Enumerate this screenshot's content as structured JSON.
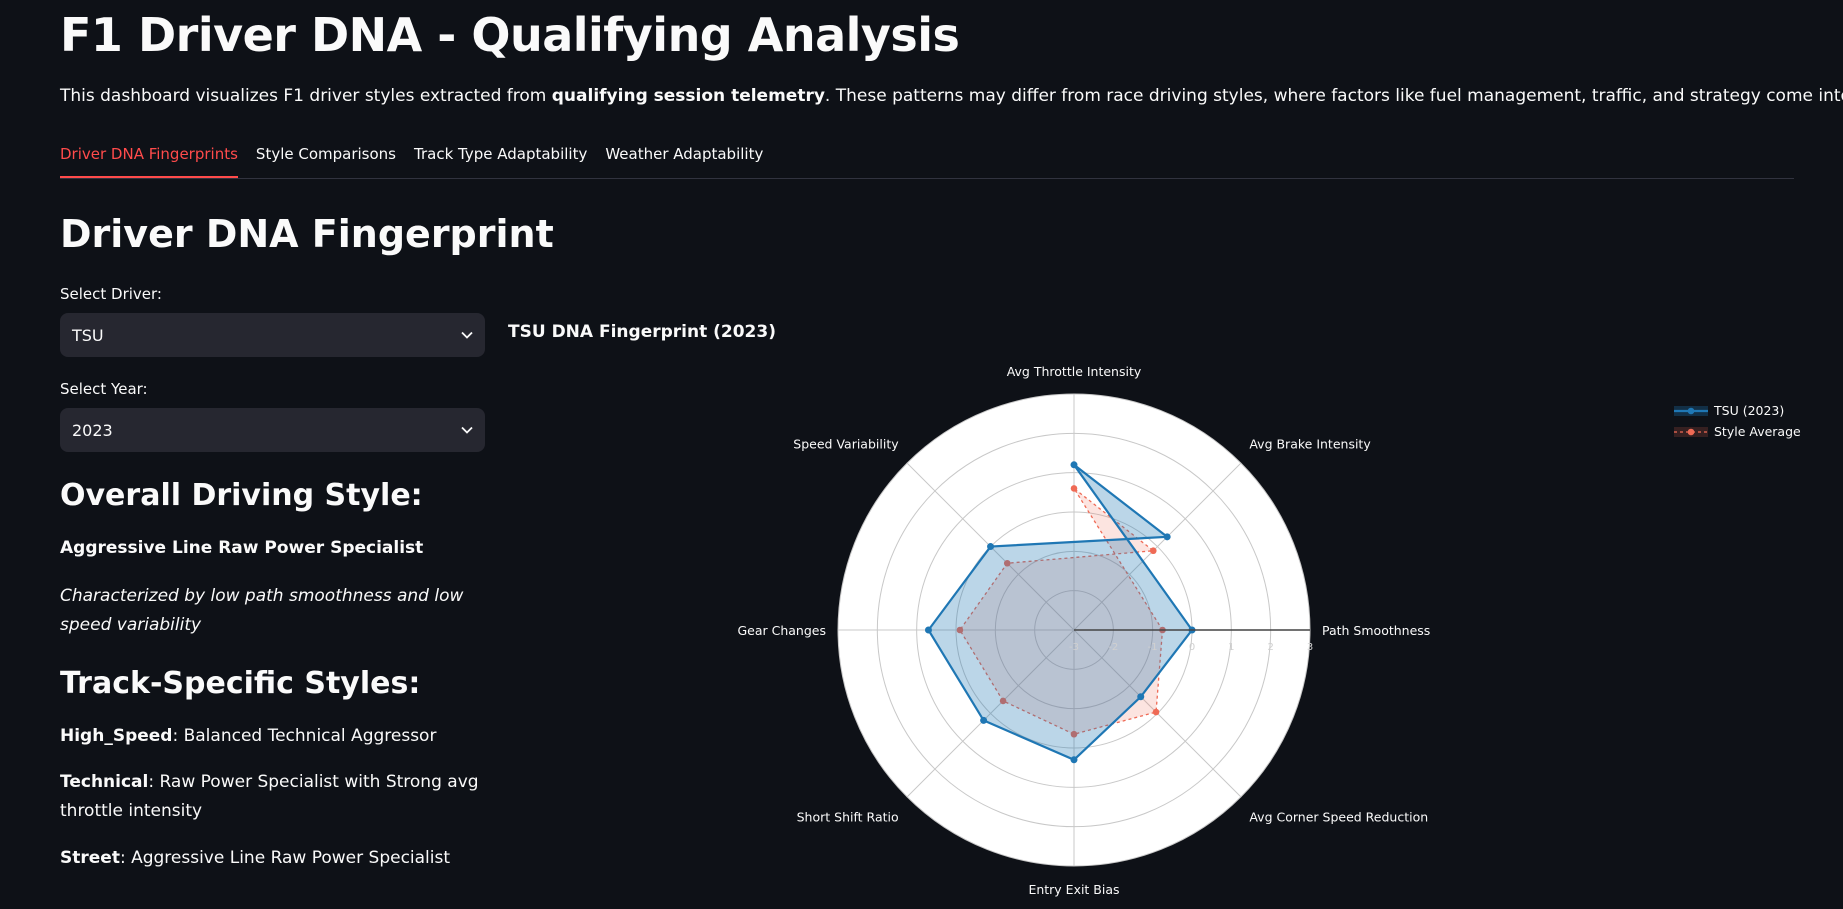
{
  "header": {
    "title": "F1 Driver DNA - Qualifying Analysis",
    "intro_prefix": "This dashboard visualizes F1 driver styles extracted from ",
    "intro_bold": "qualifying session telemetry",
    "intro_suffix": ". These patterns may differ from race driving styles, where factors like fuel management, traffic, and strategy come into play."
  },
  "tabs": [
    {
      "label": "Driver DNA Fingerprints",
      "active": true
    },
    {
      "label": "Style Comparisons",
      "active": false
    },
    {
      "label": "Track Type Adaptability",
      "active": false
    },
    {
      "label": "Weather Adaptability",
      "active": false
    }
  ],
  "section_title": "Driver DNA Fingerprint",
  "controls": {
    "driver_label": "Select Driver:",
    "driver_value": "TSU",
    "year_label": "Select Year:",
    "year_value": "2023"
  },
  "overall": {
    "heading": "Overall Driving Style:",
    "style_name": "Aggressive Line Raw Power Specialist",
    "description": "Characterized by low path smoothness and low speed variability"
  },
  "track_specific": {
    "heading": "Track-Specific Styles:",
    "items": [
      {
        "track": "High_Speed",
        "style": ": Balanced Technical Aggressor"
      },
      {
        "track": "Technical",
        "style": ": Raw Power Specialist with Strong avg throttle intensity"
      },
      {
        "track": "Street",
        "style": ": Aggressive Line Raw Power Specialist"
      }
    ]
  },
  "colors": {
    "accent": "#ff4b4b",
    "driver_series": "#1f77b4",
    "average_series": "#ef6a55",
    "background": "#0e1117"
  },
  "chart_data": {
    "type": "radar",
    "title": "TSU DNA Fingerprint (2023)",
    "axes": [
      "Path Smoothness",
      "Avg Throttle Intensity",
      "Avg Brake Intensity",
      "Speed Variability",
      "Gear Changes",
      "Short Shift Ratio",
      "Entry Exit Bias",
      "Avg Corner Speed Reduction"
    ],
    "angles_deg": [
      0,
      90,
      45,
      135,
      180,
      225,
      270,
      315
    ],
    "range": [
      -3,
      3
    ],
    "tick_values": [
      "-3",
      "-2",
      "-1",
      "0",
      "1",
      "2",
      "3"
    ],
    "series": [
      {
        "name": "TSU (2023)",
        "values": [
          0.0,
          1.2,
          0.35,
          0.0,
          0.7,
          0.25,
          0.3,
          -0.6
        ]
      },
      {
        "name": "Style Average",
        "values": [
          -0.75,
          0.6,
          -0.15,
          -0.6,
          -0.1,
          -0.45,
          -0.35,
          -0.05
        ]
      }
    ],
    "legend_position": "top-right"
  }
}
